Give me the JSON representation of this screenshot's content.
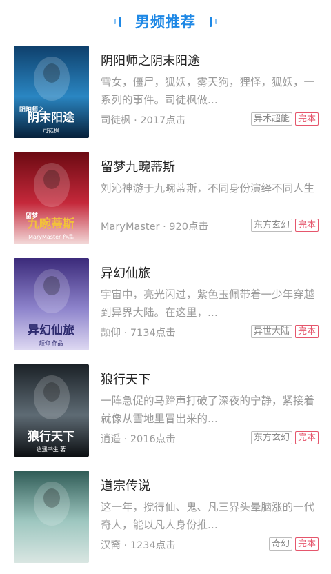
{
  "header": {
    "title": "男频推荐"
  },
  "books": [
    {
      "title": "阴阳师之阴末阳途",
      "desc": "雪女，僵尸，狐妖，雾天狗，狸怪，狐妖，一系列的事件。司徒枫做...",
      "meta": "司徒枫 · 2017点击",
      "genre": "异术超能",
      "status": "完本",
      "cover_text": "阴末阳途",
      "cover_sub": "阴阳师之",
      "cover_author": "司徒枫",
      "cover_colors": [
        "#0e3f6b",
        "#2a86c2",
        "#07203a"
      ]
    },
    {
      "title": "留梦九畹蒂斯",
      "desc": "刘沁神游于九畹蒂斯，不同身份演绎不同人生",
      "meta": "MaryMaster · 920点击",
      "genre": "东方玄幻",
      "status": "完本",
      "cover_text": "九畹蒂斯",
      "cover_sub": "留梦",
      "cover_author": "MaryMaster 作品",
      "cover_colors": [
        "#6b0a12",
        "#c4283a",
        "#f3d9d9"
      ]
    },
    {
      "title": "异幻仙旅",
      "desc": "宇宙中，亮光闪过，紫色玉佩带着一少年穿越到异界大陆。在这里，...",
      "meta": "颉仰 · 7134点击",
      "genre": "异世大陆",
      "status": "完本",
      "cover_text": "异幻仙旅",
      "cover_sub": "",
      "cover_author": "颉仰 作品",
      "cover_colors": [
        "#3b2a7a",
        "#8e84cc",
        "#ded9f2"
      ]
    },
    {
      "title": "狼行天下",
      "desc": "一阵急促的马蹄声打破了深夜的宁静，紧接着就像从雪地里冒出来的...",
      "meta": "逍遥 · 2016点击",
      "genre": "东方玄幻",
      "status": "完本",
      "cover_text": "狼行天下",
      "cover_sub": "",
      "cover_author": "逍遥书生 著",
      "cover_colors": [
        "#1b2127",
        "#5e6b74",
        "#0c0f12"
      ]
    },
    {
      "title": "道宗传说",
      "desc": "这一年，搅得仙、鬼、凡三界头晕脑涨的一代奇人，能以凡人身份推...",
      "meta": "汉裔 · 1234点击",
      "genre": "奇幻",
      "status": "完本",
      "cover_text": "",
      "cover_sub": "",
      "cover_author": "",
      "cover_colors": [
        "#2f5b56",
        "#9ec7c0",
        "#d9e6e2"
      ]
    }
  ]
}
